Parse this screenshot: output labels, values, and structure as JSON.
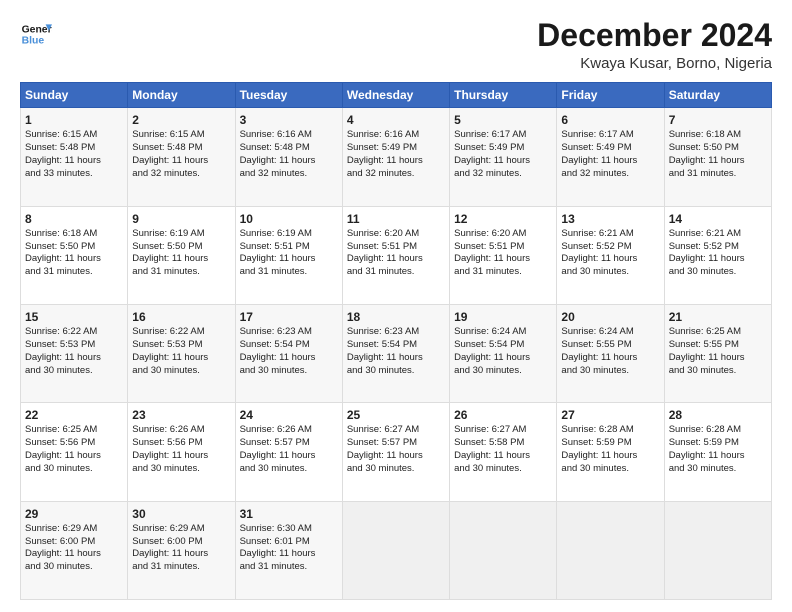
{
  "header": {
    "logo_line1": "General",
    "logo_line2": "Blue",
    "title": "December 2024",
    "subtitle": "Kwaya Kusar, Borno, Nigeria"
  },
  "days_of_week": [
    "Sunday",
    "Monday",
    "Tuesday",
    "Wednesday",
    "Thursday",
    "Friday",
    "Saturday"
  ],
  "weeks": [
    [
      {
        "day": 1,
        "lines": [
          "Sunrise: 6:15 AM",
          "Sunset: 5:48 PM",
          "Daylight: 11 hours",
          "and 33 minutes."
        ]
      },
      {
        "day": 2,
        "lines": [
          "Sunrise: 6:15 AM",
          "Sunset: 5:48 PM",
          "Daylight: 11 hours",
          "and 32 minutes."
        ]
      },
      {
        "day": 3,
        "lines": [
          "Sunrise: 6:16 AM",
          "Sunset: 5:48 PM",
          "Daylight: 11 hours",
          "and 32 minutes."
        ]
      },
      {
        "day": 4,
        "lines": [
          "Sunrise: 6:16 AM",
          "Sunset: 5:49 PM",
          "Daylight: 11 hours",
          "and 32 minutes."
        ]
      },
      {
        "day": 5,
        "lines": [
          "Sunrise: 6:17 AM",
          "Sunset: 5:49 PM",
          "Daylight: 11 hours",
          "and 32 minutes."
        ]
      },
      {
        "day": 6,
        "lines": [
          "Sunrise: 6:17 AM",
          "Sunset: 5:49 PM",
          "Daylight: 11 hours",
          "and 32 minutes."
        ]
      },
      {
        "day": 7,
        "lines": [
          "Sunrise: 6:18 AM",
          "Sunset: 5:50 PM",
          "Daylight: 11 hours",
          "and 31 minutes."
        ]
      }
    ],
    [
      {
        "day": 8,
        "lines": [
          "Sunrise: 6:18 AM",
          "Sunset: 5:50 PM",
          "Daylight: 11 hours",
          "and 31 minutes."
        ]
      },
      {
        "day": 9,
        "lines": [
          "Sunrise: 6:19 AM",
          "Sunset: 5:50 PM",
          "Daylight: 11 hours",
          "and 31 minutes."
        ]
      },
      {
        "day": 10,
        "lines": [
          "Sunrise: 6:19 AM",
          "Sunset: 5:51 PM",
          "Daylight: 11 hours",
          "and 31 minutes."
        ]
      },
      {
        "day": 11,
        "lines": [
          "Sunrise: 6:20 AM",
          "Sunset: 5:51 PM",
          "Daylight: 11 hours",
          "and 31 minutes."
        ]
      },
      {
        "day": 12,
        "lines": [
          "Sunrise: 6:20 AM",
          "Sunset: 5:51 PM",
          "Daylight: 11 hours",
          "and 31 minutes."
        ]
      },
      {
        "day": 13,
        "lines": [
          "Sunrise: 6:21 AM",
          "Sunset: 5:52 PM",
          "Daylight: 11 hours",
          "and 30 minutes."
        ]
      },
      {
        "day": 14,
        "lines": [
          "Sunrise: 6:21 AM",
          "Sunset: 5:52 PM",
          "Daylight: 11 hours",
          "and 30 minutes."
        ]
      }
    ],
    [
      {
        "day": 15,
        "lines": [
          "Sunrise: 6:22 AM",
          "Sunset: 5:53 PM",
          "Daylight: 11 hours",
          "and 30 minutes."
        ]
      },
      {
        "day": 16,
        "lines": [
          "Sunrise: 6:22 AM",
          "Sunset: 5:53 PM",
          "Daylight: 11 hours",
          "and 30 minutes."
        ]
      },
      {
        "day": 17,
        "lines": [
          "Sunrise: 6:23 AM",
          "Sunset: 5:54 PM",
          "Daylight: 11 hours",
          "and 30 minutes."
        ]
      },
      {
        "day": 18,
        "lines": [
          "Sunrise: 6:23 AM",
          "Sunset: 5:54 PM",
          "Daylight: 11 hours",
          "and 30 minutes."
        ]
      },
      {
        "day": 19,
        "lines": [
          "Sunrise: 6:24 AM",
          "Sunset: 5:54 PM",
          "Daylight: 11 hours",
          "and 30 minutes."
        ]
      },
      {
        "day": 20,
        "lines": [
          "Sunrise: 6:24 AM",
          "Sunset: 5:55 PM",
          "Daylight: 11 hours",
          "and 30 minutes."
        ]
      },
      {
        "day": 21,
        "lines": [
          "Sunrise: 6:25 AM",
          "Sunset: 5:55 PM",
          "Daylight: 11 hours",
          "and 30 minutes."
        ]
      }
    ],
    [
      {
        "day": 22,
        "lines": [
          "Sunrise: 6:25 AM",
          "Sunset: 5:56 PM",
          "Daylight: 11 hours",
          "and 30 minutes."
        ]
      },
      {
        "day": 23,
        "lines": [
          "Sunrise: 6:26 AM",
          "Sunset: 5:56 PM",
          "Daylight: 11 hours",
          "and 30 minutes."
        ]
      },
      {
        "day": 24,
        "lines": [
          "Sunrise: 6:26 AM",
          "Sunset: 5:57 PM",
          "Daylight: 11 hours",
          "and 30 minutes."
        ]
      },
      {
        "day": 25,
        "lines": [
          "Sunrise: 6:27 AM",
          "Sunset: 5:57 PM",
          "Daylight: 11 hours",
          "and 30 minutes."
        ]
      },
      {
        "day": 26,
        "lines": [
          "Sunrise: 6:27 AM",
          "Sunset: 5:58 PM",
          "Daylight: 11 hours",
          "and 30 minutes."
        ]
      },
      {
        "day": 27,
        "lines": [
          "Sunrise: 6:28 AM",
          "Sunset: 5:59 PM",
          "Daylight: 11 hours",
          "and 30 minutes."
        ]
      },
      {
        "day": 28,
        "lines": [
          "Sunrise: 6:28 AM",
          "Sunset: 5:59 PM",
          "Daylight: 11 hours",
          "and 30 minutes."
        ]
      }
    ],
    [
      {
        "day": 29,
        "lines": [
          "Sunrise: 6:29 AM",
          "Sunset: 6:00 PM",
          "Daylight: 11 hours",
          "and 30 minutes."
        ]
      },
      {
        "day": 30,
        "lines": [
          "Sunrise: 6:29 AM",
          "Sunset: 6:00 PM",
          "Daylight: 11 hours",
          "and 31 minutes."
        ]
      },
      {
        "day": 31,
        "lines": [
          "Sunrise: 6:30 AM",
          "Sunset: 6:01 PM",
          "Daylight: 11 hours",
          "and 31 minutes."
        ]
      },
      null,
      null,
      null,
      null
    ]
  ]
}
